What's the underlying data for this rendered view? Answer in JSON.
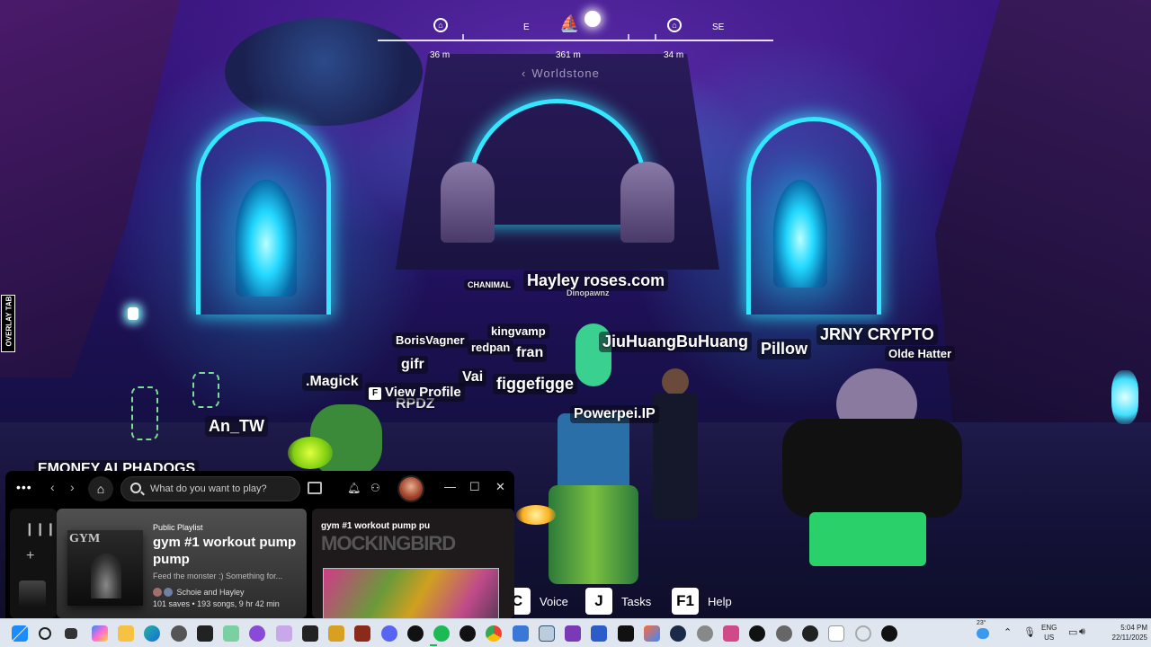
{
  "compass": {
    "directions": [
      "E",
      "SE"
    ],
    "distances": [
      "36 m",
      "361 m",
      "34 m"
    ],
    "location": "Worldstone"
  },
  "nametags": {
    "hayley": "Hayley roses.com",
    "chanimal": "CHANIMAL",
    "dinopawnz": "Dinopawnz",
    "kingvamp": "kingvamp",
    "borisvagner": "BorisVagner",
    "redpan": "redpan",
    "fran": "fran",
    "gifr": "gifr",
    "vai": "Vai",
    "figgefigge": "figgefigge",
    "magick": ".Magick",
    "jiuhuang": "JiuHuangBuHuang",
    "pillow": "Pillow",
    "jrny": "JRNY CRYPTO",
    "oldehatter": "Olde Hatter",
    "powerpei": "Powerpei.IP",
    "an_tw": "An_TW",
    "emoney": "EMONEY ALPHADOGS",
    "rpdz": "RPDZ"
  },
  "view_profile": {
    "key": "F",
    "label": "View Profile"
  },
  "overlay_tab": "OVERLAY TAB",
  "hotkeys": [
    {
      "key": "C",
      "label": "Voice"
    },
    {
      "key": "J",
      "label": "Tasks"
    },
    {
      "key": "F1",
      "label": "Help"
    }
  ],
  "spotify": {
    "search_placeholder": "What do you want to play?",
    "playlist": {
      "type": "Public Playlist",
      "title": "gym #1 workout pump pump",
      "description": "Feed the monster :) Something for...",
      "owners": "Schoie and Hayley",
      "stats": "101 saves • 193 songs, 9 hr 42 min",
      "cover_text": "GYM"
    },
    "now_playing": {
      "title": "gym #1 workout pump pu",
      "artist": "MOCKINGBIRD"
    }
  },
  "taskbar": {
    "temperature": "23°",
    "language": "ENG",
    "region": "US",
    "time": "5:04 PM",
    "date": "22/11/2025"
  },
  "colors": {
    "accent_cyan": "#35e6ff",
    "spotify_green": "#1db954"
  }
}
